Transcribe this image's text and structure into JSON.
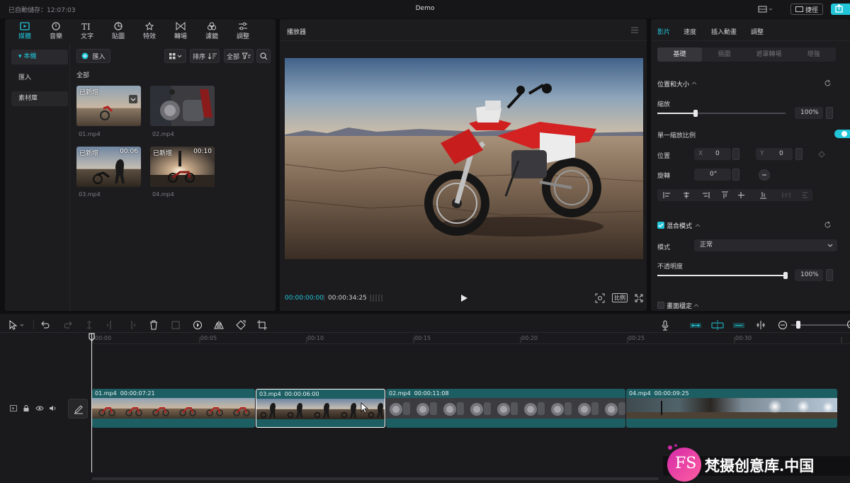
{
  "app": {
    "autosave": "已自動儲存：12:07:03",
    "title": "Demo",
    "shortcut_label": "捷徑"
  },
  "media_tabs": [
    {
      "label": "媒體",
      "icon": "media-icon",
      "active": true
    },
    {
      "label": "音樂",
      "icon": "music-icon"
    },
    {
      "label": "文字",
      "icon": "text-icon"
    },
    {
      "label": "貼圖",
      "icon": "sticker-icon"
    },
    {
      "label": "特效",
      "icon": "effects-icon"
    },
    {
      "label": "轉場",
      "icon": "transition-icon"
    },
    {
      "label": "濾鏡",
      "icon": "filter-icon"
    },
    {
      "label": "調整",
      "icon": "adjust-icon"
    }
  ],
  "sidebar": {
    "items": [
      "▾ 本機",
      "匯入",
      "素材庫"
    ]
  },
  "media": {
    "import_label": "匯入",
    "sort_label": "排序",
    "all_filter_label": "全部",
    "section_label": "全部",
    "files": [
      {
        "name": "01.mp4",
        "badge": "已新增",
        "duration": ""
      },
      {
        "name": "02.mp4",
        "badge": "",
        "duration": ""
      },
      {
        "name": "03.mp4",
        "badge": "已新增",
        "duration": "00:06"
      },
      {
        "name": "04.mp4",
        "badge": "已新增",
        "duration": "00:10"
      }
    ]
  },
  "player": {
    "title": "播放器",
    "current_time": "00:00:00:00",
    "total_time": "00:00:34:25",
    "ratio_label": "比例"
  },
  "props": {
    "tabs": [
      "影片",
      "速度",
      "插入動畫",
      "調整"
    ],
    "subtabs": [
      "基礎",
      "摳圖",
      "遮罩轉場",
      "增強"
    ],
    "position_size": "位置和大小",
    "scale_label": "縮放",
    "scale_value": "100%",
    "scale_fraction": 0.3,
    "uniform_scale": "單一縮放比例",
    "position_label": "位置",
    "x_label": "X",
    "x_value": "0",
    "y_label": "Y",
    "y_value": "0",
    "rotate_label": "旋轉",
    "rotate_value": "0°",
    "blend_label": "混合模式",
    "mode_label": "模式",
    "mode_value": "正常",
    "opacity_label": "不透明度",
    "opacity_value": "100%",
    "opacity_fraction": 1.0,
    "stabilize_label": "畫面穩定"
  },
  "timeline": {
    "ruler": [
      "00:00",
      "00:05",
      "00:10",
      "00:15",
      "00:20",
      "00:25",
      "00:30"
    ],
    "clips": [
      {
        "name": "01.mp4",
        "duration": "00:00:07:21"
      },
      {
        "name": "03.mp4",
        "duration": "00:00:06:00"
      },
      {
        "name": "02.mp4",
        "duration": "00:00:11:08"
      },
      {
        "name": "04.mp4",
        "duration": "00:00:09:25"
      }
    ]
  },
  "watermark": {
    "text": "梵摄创意库.中国",
    "logo": "FS"
  },
  "colors": {
    "accent": "#22c5d8",
    "clip": "#1d5e62"
  }
}
